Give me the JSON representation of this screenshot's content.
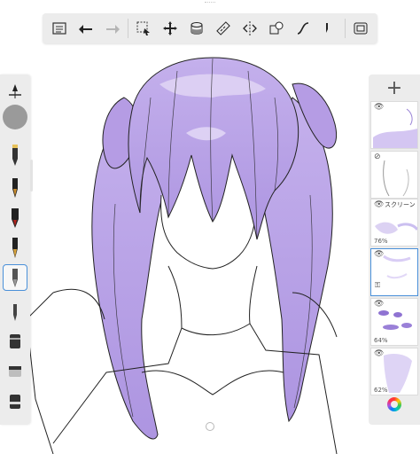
{
  "toolbar": {
    "items": [
      {
        "name": "layers-list-icon"
      },
      {
        "name": "undo-icon"
      },
      {
        "name": "redo-icon"
      },
      {
        "name": "selection-icon"
      },
      {
        "name": "transform-icon"
      },
      {
        "name": "fill-bucket-icon"
      },
      {
        "name": "ruler-icon"
      },
      {
        "name": "symmetry-icon"
      },
      {
        "name": "shapes-icon"
      },
      {
        "name": "stroke-style-icon"
      },
      {
        "name": "brush-size-icon"
      },
      {
        "name": "fullscreen-icon"
      }
    ]
  },
  "left_panel": {
    "tools": [
      {
        "name": "brush-set-icon"
      },
      {
        "name": "pencil-icon"
      },
      {
        "name": "ink-pen-icon"
      },
      {
        "name": "marker-icon"
      },
      {
        "name": "fountain-pen-icon"
      },
      {
        "name": "selected-pen-icon"
      },
      {
        "name": "fine-pen-icon"
      },
      {
        "name": "airbrush-icon"
      },
      {
        "name": "eraser-icon"
      },
      {
        "name": "smudge-icon"
      }
    ]
  },
  "layers": {
    "items": [
      {
        "label": "",
        "opacity": ""
      },
      {
        "label": "",
        "opacity": ""
      },
      {
        "label": "スクリーン",
        "opacity": "76%"
      },
      {
        "label": "",
        "opacity": ""
      },
      {
        "label": "",
        "opacity": "64%"
      },
      {
        "label": "",
        "opacity": "62%"
      }
    ],
    "add_label": "+"
  },
  "colors": {
    "hair": "#b9a2e6",
    "hair_shadow": "#9f86d9",
    "hair_highlight": "#d9ccf2",
    "accent": "#4a90d9"
  }
}
